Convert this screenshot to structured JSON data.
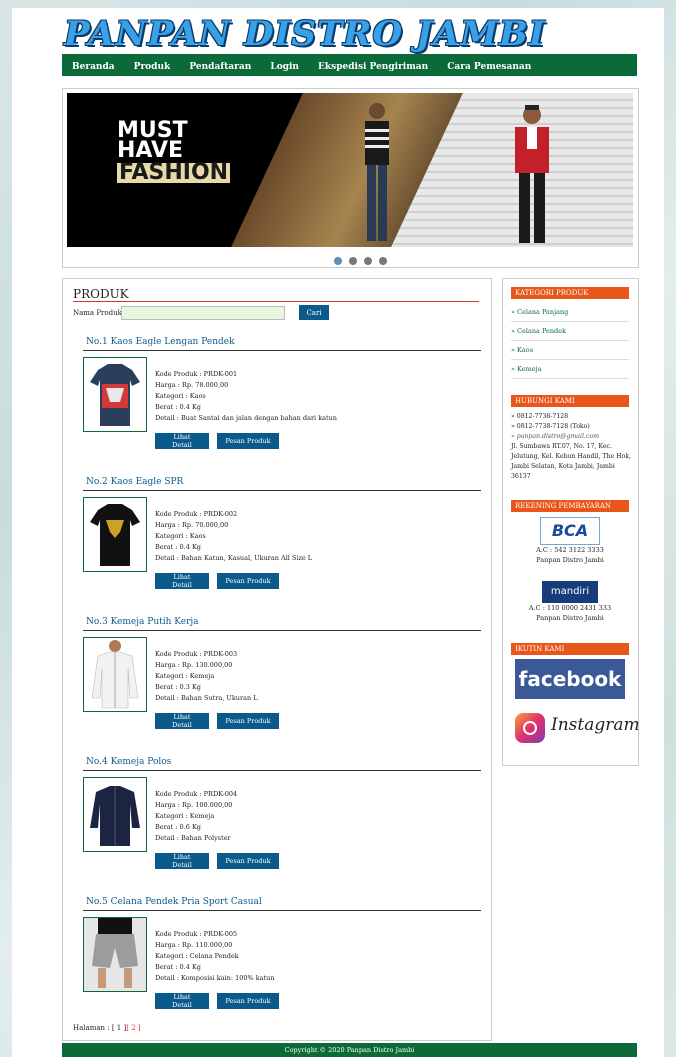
{
  "site": {
    "logo": "PANPAN DISTRO JAMBI"
  },
  "nav": [
    "Beranda",
    "Produk",
    "Pendaftaran",
    "Login",
    "Ekspedisi Pengiriman",
    "Cara Pemesanan"
  ],
  "banner": {
    "line1": "MUST",
    "line2": "HAVE",
    "line3": "FASHION"
  },
  "main": {
    "title": "PRODUK",
    "search_label": "Nama Produk :",
    "search_value": "",
    "search_button": "Cari",
    "view_button": "Lihat Detail",
    "order_button": "Pesan Produk",
    "products": [
      {
        "title": "No.1 Kaos Eagle Lengan Pendek",
        "kode": "Kode Produk : PRDK-001",
        "harga": "Harga : Rp. 78.000,00",
        "kategori": "Kategori : Kaos",
        "berat": "Berat : 0.4 Kg",
        "detail": "Detail : Buat Santai dan jalan dengan bahan dari katun"
      },
      {
        "title": "No.2 Kaos Eagle SPR",
        "kode": "Kode Produk : PRDK-002",
        "harga": "Harga : Rp. 70.000,00",
        "kategori": "Kategori : Kaos",
        "berat": "Berat : 0.4 Kg",
        "detail": "Detail : Bahan Katun, Kasual, Ukuran All Size L"
      },
      {
        "title": "No.3 Kemeja Putih Kerja",
        "kode": "Kode Produk : PRDK-003",
        "harga": "Harga : Rp. 130.000,00",
        "kategori": "Kategori : Kemeja",
        "berat": "Berat : 0.3 Kg",
        "detail": "Detail : Bahan Sutra, Ukuran L"
      },
      {
        "title": "No.4 Kemeja Polos",
        "kode": "Kode Produk : PRDK-004",
        "harga": "Harga : Rp. 100.000,00",
        "kategori": "Kategori : Kemeja",
        "berat": "Berat : 0.6 Kg",
        "detail": "Detail : Bahan Polyster"
      },
      {
        "title": "No.5 Celana Pendek Pria Sport Casual",
        "kode": "Kode Produk : PRDK-005",
        "harga": "Harga : Rp. 110.000,00",
        "kategori": "Kategori : Celana Pendek",
        "berat": "Berat : 0.4 Kg",
        "detail": "Detail : Komposisi kain: 100% katun"
      }
    ],
    "pager_label": "Halaman :",
    "pager_current": "[ 1 ]",
    "pager_next": "[ 2 ]"
  },
  "sidebar": {
    "categories_title": "KATEGORI PRODUK",
    "categories": [
      "» Celana Panjang",
      "» Celana Pendek",
      "» Kaos",
      "» Kemeja"
    ],
    "contact_title": "HUBUNGI KAMI",
    "phone1": "» 0812-7738-7128",
    "phone2": "» 0812-7738-7128 (Toko)",
    "email": "» panpan.distro@gmail.com",
    "address": "Jl. Sumbawa RT.07, No. 17, Kec. Jelutung, Kel. Kebun Handil, The Hok, Jambi Selatan, Kota Jambi, Jambi 36137",
    "bank_title": "REKENING PEMBAYARAN",
    "bank1_logo": "BCA",
    "bank1_account": "A.C : 542 3122 3333",
    "bank1_name": "Panpan Distro Jambi",
    "bank2_logo": "mandiri",
    "bank2_account": "A.C : 110 0000 2431 333",
    "bank2_name": "Panpan Distro Jambi",
    "follow_title": "IKUTIN KAMI",
    "facebook": "facebook",
    "instagram": "Instagram"
  },
  "footer": "Copyright © 2020 Panpan Distro Jambi"
}
